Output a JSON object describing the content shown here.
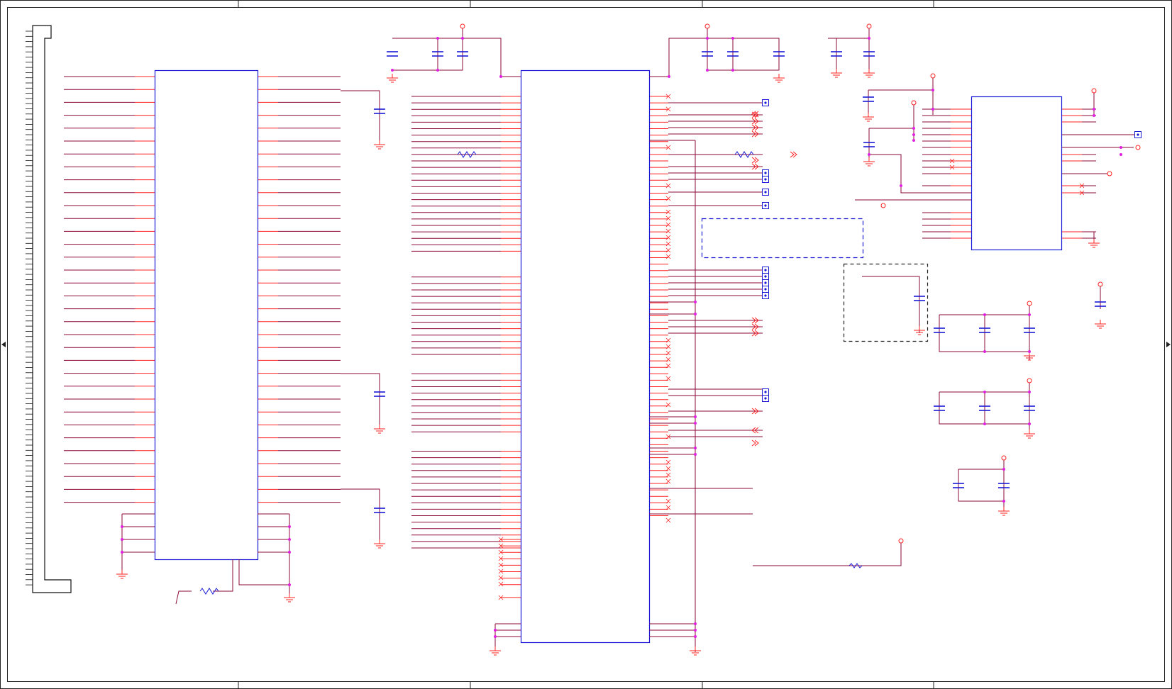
{
  "sheet": {
    "title_block": "",
    "border_zones_top": [
      "",
      "",
      "",
      "",
      ""
    ],
    "border_zones_side": [
      "",
      "",
      ""
    ]
  },
  "components": {
    "edge_connector": {
      "label": ""
    },
    "u_left": {
      "designator": "",
      "part": ""
    },
    "u_center": {
      "designator": "",
      "part": ""
    },
    "u_right": {
      "designator": "",
      "part": ""
    }
  },
  "annotations": {
    "dashed_note_box": "",
    "dashed_rf_box": ""
  },
  "colors": {
    "wire": "#8b0a3a",
    "pin": "#ff2020",
    "body": "#1a1ad6",
    "junction": "#e020e0",
    "power": "#ff2020",
    "frame": "#222222"
  }
}
